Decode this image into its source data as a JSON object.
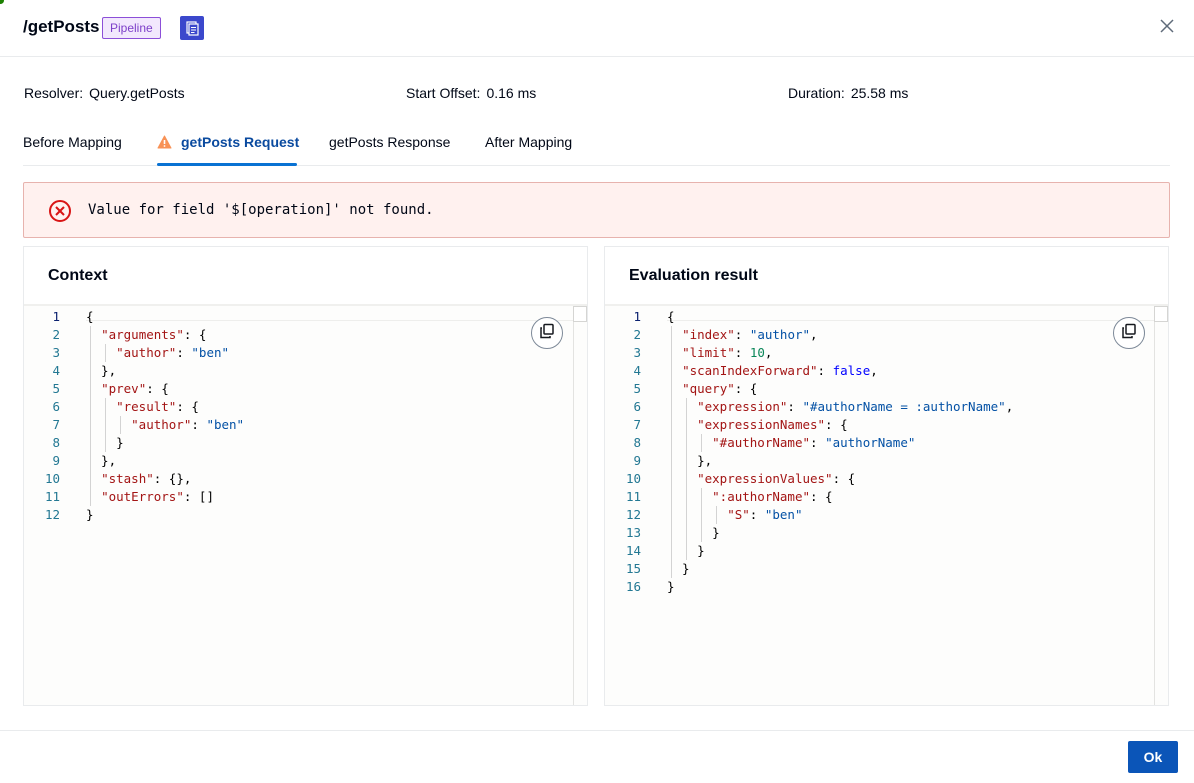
{
  "modal": {
    "title": "/getPosts",
    "badge": "Pipeline",
    "pipeline_icon": "document-stack-icon",
    "close_icon": "close-icon"
  },
  "meta": {
    "resolver_label": "Resolver:",
    "resolver_value": "Query.getPosts",
    "offset_label": "Start Offset:",
    "offset_value": "0.16 ms",
    "duration_label": "Duration:",
    "duration_value": "25.58 ms"
  },
  "tabs": [
    {
      "label": "Before Mapping",
      "active": false
    },
    {
      "label": "getPosts Request",
      "active": true,
      "icon": "warning-icon"
    },
    {
      "label": "getPosts Response",
      "active": false
    },
    {
      "label": "After Mapping",
      "active": false
    }
  ],
  "alert": {
    "icon": "error-circle-icon",
    "message": "Value for field '$[operation]' not found."
  },
  "context_panel": {
    "title": "Context",
    "copy_icon": "copy-icon",
    "lines": [
      {
        "n": "1",
        "text": "{"
      },
      {
        "n": "2",
        "text": "  \"arguments\": {"
      },
      {
        "n": "3",
        "text": "    \"author\": \"ben\""
      },
      {
        "n": "4",
        "text": "  },"
      },
      {
        "n": "5",
        "text": "  \"prev\": {"
      },
      {
        "n": "6",
        "text": "    \"result\": {"
      },
      {
        "n": "7",
        "text": "      \"author\": \"ben\""
      },
      {
        "n": "8",
        "text": "    }"
      },
      {
        "n": "9",
        "text": "  },"
      },
      {
        "n": "10",
        "text": "  \"stash\": {},"
      },
      {
        "n": "11",
        "text": "  \"outErrors\": []"
      },
      {
        "n": "12",
        "text": "}"
      }
    ]
  },
  "result_panel": {
    "title": "Evaluation result",
    "copy_icon": "copy-icon",
    "lines": [
      {
        "n": "1",
        "text": "{"
      },
      {
        "n": "2",
        "text": "  \"index\": \"author\","
      },
      {
        "n": "3",
        "text": "  \"limit\": 10,"
      },
      {
        "n": "4",
        "text": "  \"scanIndexForward\": false,"
      },
      {
        "n": "5",
        "text": "  \"query\": {"
      },
      {
        "n": "6",
        "text": "    \"expression\": \"#authorName = :authorName\","
      },
      {
        "n": "7",
        "text": "    \"expressionNames\": {"
      },
      {
        "n": "8",
        "text": "      \"#authorName\": \"authorName\""
      },
      {
        "n": "9",
        "text": "    },"
      },
      {
        "n": "10",
        "text": "    \"expressionValues\": {"
      },
      {
        "n": "11",
        "text": "      \":authorName\": {"
      },
      {
        "n": "12",
        "text": "        \"S\": \"ben\""
      },
      {
        "n": "13",
        "text": "      }"
      },
      {
        "n": "14",
        "text": "    }"
      },
      {
        "n": "15",
        "text": "  }"
      },
      {
        "n": "16",
        "text": "}"
      }
    ]
  },
  "footer": {
    "ok_label": "Ok"
  },
  "colors": {
    "primary": "#0b55b8",
    "tab_active": "#0a4a9f",
    "error": "#d91515",
    "warning": "#f89256",
    "badge_border": "#8c4fd8",
    "badge_bg": "#f2e8fd",
    "json_key": "#a31515",
    "json_string": "#0451a5",
    "json_number": "#098658",
    "json_bool": "#0000ff"
  }
}
